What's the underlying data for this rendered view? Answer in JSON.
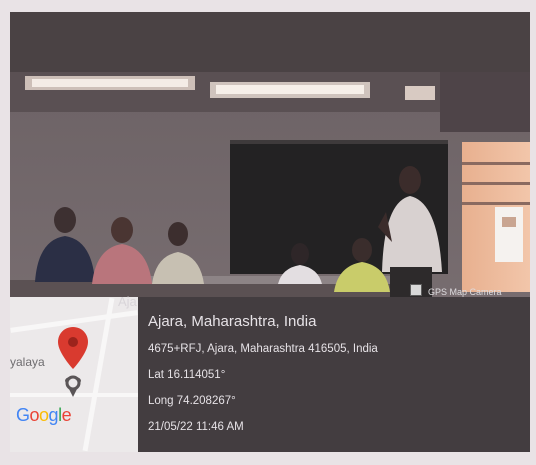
{
  "overlay": {
    "badge_text": "GPS Map Camera",
    "cut_text": "Aja",
    "title": "Ajara, Maharashtra, India",
    "address": "4675+RFJ, Ajara, Maharashtra 416505, India",
    "lat": "Lat 16.114051°",
    "long": "Long 74.208267°",
    "datetime": "21/05/22 11:46 AM"
  },
  "map": {
    "place_label": "yalaya",
    "logo": "Google",
    "logo_colors": [
      "#4285F4",
      "#EA4335",
      "#FBBC05",
      "#4285F4",
      "#34A853",
      "#EA4335"
    ],
    "pin_color": "#d93a2f",
    "icon": "map-pin-icon"
  }
}
